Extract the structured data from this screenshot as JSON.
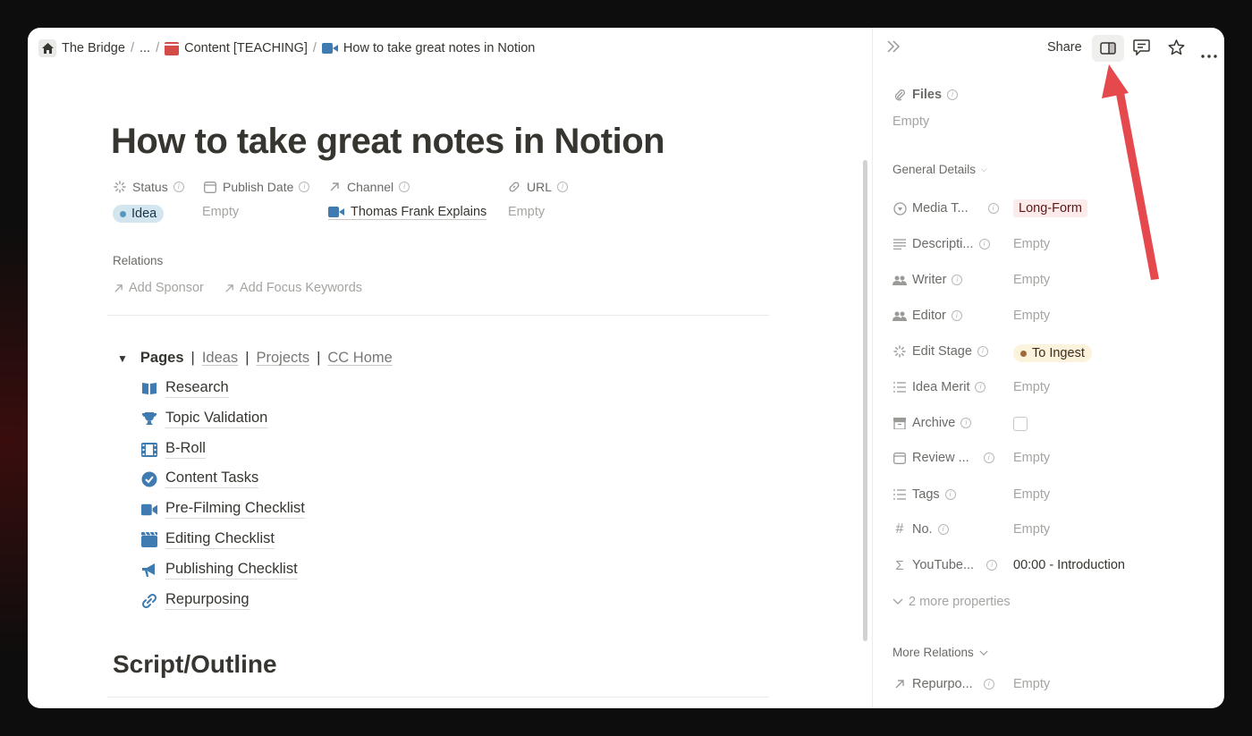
{
  "breadcrumb": {
    "items": [
      "The Bridge",
      "...",
      "Content [TEACHING]",
      "How to take great notes in Notion"
    ],
    "sep": "/"
  },
  "header": {
    "share_label": "Share",
    "icons": [
      "collapse-panel-icon",
      "side-peek-icon",
      "comment-icon",
      "star-icon",
      "more-icon"
    ]
  },
  "page": {
    "title": "How to take great notes in Notion",
    "props": {
      "status": {
        "label": "Status",
        "value": "Idea"
      },
      "publish_date": {
        "label": "Publish Date",
        "value": "Empty"
      },
      "channel": {
        "label": "Channel",
        "value": "Thomas Frank Explains"
      },
      "url": {
        "label": "URL",
        "value": "Empty"
      }
    },
    "relations": {
      "label": "Relations",
      "add_sponsor": "Add Sponsor",
      "add_focus": "Add Focus Keywords"
    },
    "pages_toggle": {
      "label": "Pages",
      "sep": "|",
      "links": [
        "Ideas",
        "Projects",
        "CC Home"
      ]
    },
    "page_list": [
      {
        "label": "Research",
        "icon": "book-icon"
      },
      {
        "label": "Topic Validation",
        "icon": "trophy-icon"
      },
      {
        "label": "B-Roll",
        "icon": "film-icon"
      },
      {
        "label": "Content Tasks",
        "icon": "check-circle-icon"
      },
      {
        "label": "Pre-Filming Checklist",
        "icon": "camera-icon"
      },
      {
        "label": "Editing Checklist",
        "icon": "clapper-icon"
      },
      {
        "label": "Publishing Checklist",
        "icon": "megaphone-icon"
      },
      {
        "label": "Repurposing",
        "icon": "link-icon"
      }
    ],
    "heading2": "Script/Outline"
  },
  "side": {
    "files": {
      "label": "Files",
      "value": "Empty"
    },
    "general_details": "General Details",
    "props": [
      {
        "label": "Media T...",
        "value": "Long-Form",
        "icon": "media-type-icon"
      },
      {
        "label": "Descripti...",
        "value": "Empty",
        "icon": "text-icon"
      },
      {
        "label": "Writer",
        "value": "Empty",
        "icon": "people-icon"
      },
      {
        "label": "Editor",
        "value": "Empty",
        "icon": "people-icon"
      },
      {
        "label": "Edit Stage",
        "value": "To Ingest",
        "icon": "status-icon"
      },
      {
        "label": "Idea Merit",
        "value": "Empty",
        "icon": "list-icon"
      },
      {
        "label": "Archive",
        "value": "",
        "icon": "archive-icon"
      },
      {
        "label": "Review ...",
        "value": "Empty",
        "icon": "calendar-icon"
      },
      {
        "label": "Tags",
        "value": "Empty",
        "icon": "list-icon"
      },
      {
        "label": "No.",
        "value": "Empty",
        "icon": "hash-icon"
      },
      {
        "label": "YouTube...",
        "value": "00:00 - Introduction",
        "icon": "sigma-icon"
      }
    ],
    "more_properties": "2 more properties",
    "more_relations": "More Relations",
    "relation_prop": {
      "label": "Repurpo...",
      "value": "Empty"
    }
  },
  "colors": {
    "accent_red_arrow": "#e5484d",
    "idea_pill": "#d3e5ef",
    "longform_tag": "#fdebec",
    "ingest_tag": "#fbf3db",
    "icon_blue": "#3f7bb0"
  }
}
